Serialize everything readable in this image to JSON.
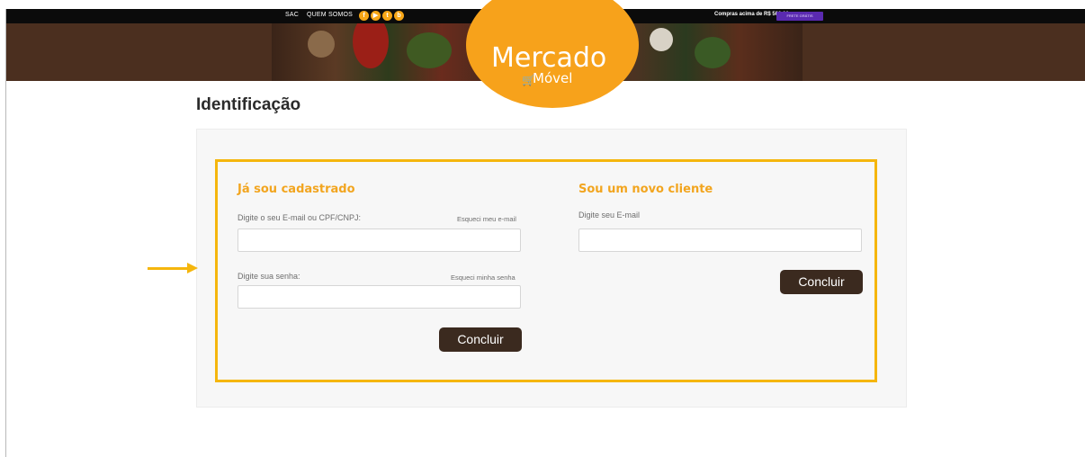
{
  "topbar": {
    "links": [
      "SAC",
      "QUEM SOMOS"
    ],
    "social_icons": [
      "facebook-icon",
      "youtube-icon",
      "twitter-icon",
      "blog-icon"
    ],
    "promo_text": "Compras acima de R$ 500,00",
    "promo_badge": "FRETE GRÁTIS"
  },
  "logo": {
    "line1": "Mercado",
    "line2": "Móvel"
  },
  "page": {
    "title": "Identificação"
  },
  "login": {
    "title": "Já sou cadastrado",
    "email_label": "Digite o seu E-mail ou  CPF/CNPJ:",
    "forgot_email": "Esqueci meu e-mail",
    "email_value": "",
    "password_label": "Digite sua senha:",
    "forgot_password": "Esqueci minha senha",
    "password_value": "",
    "submit": "Concluir"
  },
  "register": {
    "title": "Sou um novo cliente",
    "email_label": "Digite seu E-mail",
    "email_value": "",
    "submit": "Concluir"
  },
  "colors": {
    "accent": "#f2a51f",
    "highlight": "#f5b60d",
    "button": "#3b2a1f",
    "banner": "#4b2f1f"
  }
}
